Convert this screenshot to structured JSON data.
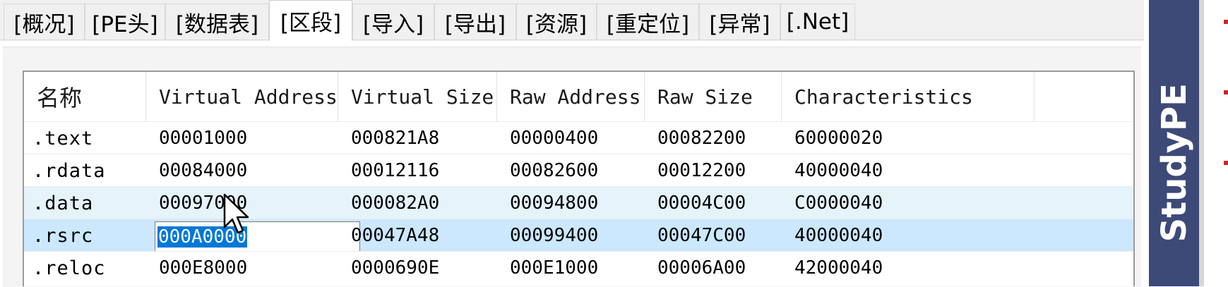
{
  "tabs": [
    {
      "label": "[概况]",
      "active": false
    },
    {
      "label": "[PE头]",
      "active": false
    },
    {
      "label": "[数据表]",
      "active": false
    },
    {
      "label": "[区段]",
      "active": true
    },
    {
      "label": "[导入]",
      "active": false
    },
    {
      "label": "[导出]",
      "active": false
    },
    {
      "label": "[资源]",
      "active": false
    },
    {
      "label": "[重定位]",
      "active": false
    },
    {
      "label": "[异常]",
      "active": false
    },
    {
      "label": "[.Net]",
      "active": false
    }
  ],
  "sections_table": {
    "columns": [
      "名称",
      "Virtual Address",
      "Virtual Size",
      "Raw Address",
      "Raw Size",
      "Characteristics"
    ],
    "rows": [
      {
        "name": ".text",
        "virtual_address": "00001000",
        "virtual_size": "000821A8",
        "raw_address": "00000400",
        "raw_size": "00082200",
        "characteristics": "60000020"
      },
      {
        "name": ".rdata",
        "virtual_address": "00084000",
        "virtual_size": "00012116",
        "raw_address": "00082600",
        "raw_size": "00012200",
        "characteristics": "40000040"
      },
      {
        "name": ".data",
        "virtual_address": "00097000",
        "virtual_size": "000082A0",
        "raw_address": "00094800",
        "raw_size": "00004C00",
        "characteristics": "C0000040"
      },
      {
        "name": ".rsrc",
        "virtual_address": "000A0000",
        "virtual_size": "00047A48",
        "raw_address": "00099400",
        "raw_size": "00047C00",
        "characteristics": "40000040"
      },
      {
        "name": ".reloc",
        "virtual_address": "000E8000",
        "virtual_size": "0000690E",
        "raw_address": "000E1000",
        "raw_size": "00006A00",
        "characteristics": "42000040"
      }
    ],
    "hover_row": 2,
    "selected_row": 3,
    "editing": {
      "row": 3,
      "column": "virtual_address",
      "value": "000A0000"
    }
  },
  "side_panel": {
    "title": "StudyPE",
    "color": "#3d4a78"
  },
  "colors": {
    "selected_row": "#cce8ff",
    "hover_row": "#e5f3fb",
    "text_selection": "#0078d7"
  },
  "icons": {
    "cursor": "arrow-cursor-icon"
  }
}
